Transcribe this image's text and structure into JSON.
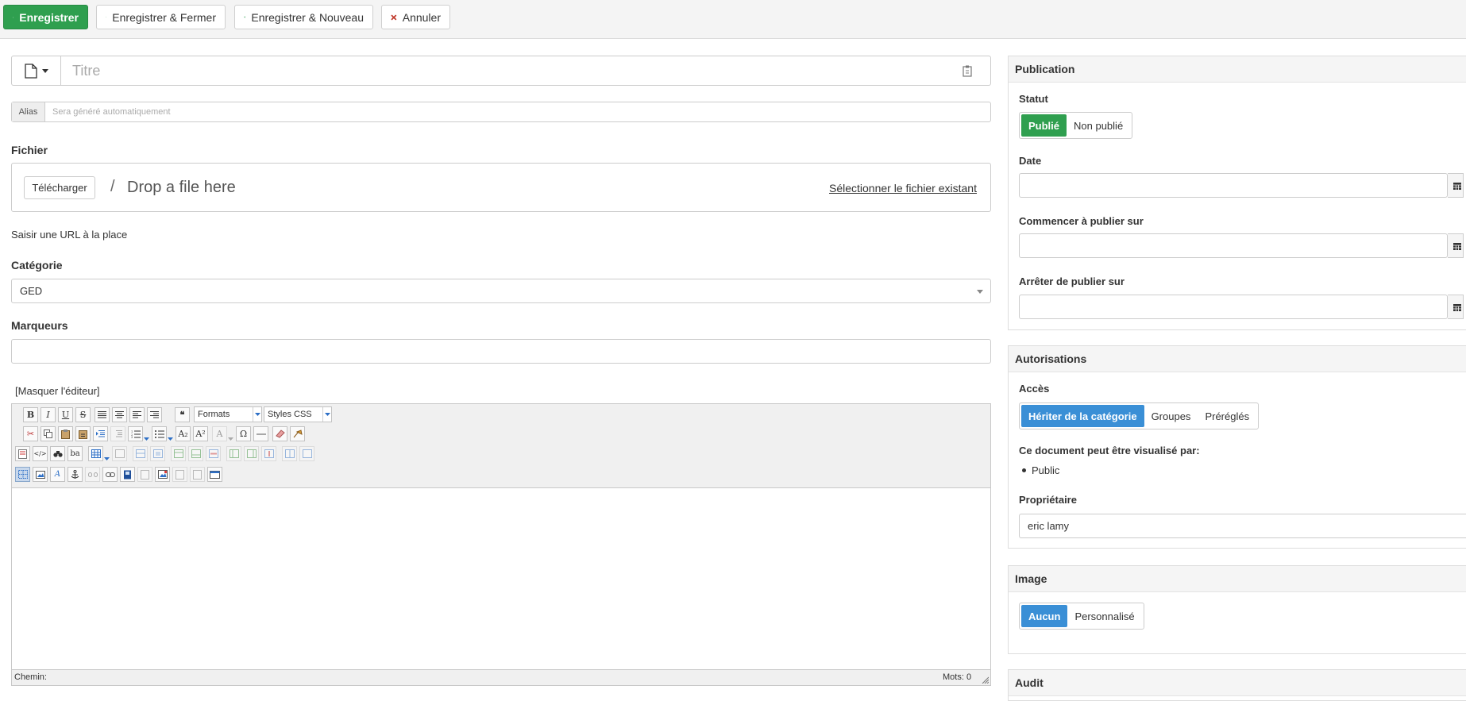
{
  "toolbar": {
    "save": "Enregistrer",
    "save_close": "Enregistrer & Fermer",
    "save_new": "Enregistrer & Nouveau",
    "cancel": "Annuler"
  },
  "form": {
    "title_placeholder": "Titre",
    "alias_label": "Alias",
    "alias_placeholder": "Sera généré automatiquement",
    "file_label": "Fichier",
    "upload_button": "Télécharger",
    "slash": "/",
    "drop_text": "Drop a file here",
    "select_existing": "Sélectionner le fichier existant",
    "enter_url": "Saisir une URL à la place",
    "category_label": "Catégorie",
    "category_value": "GED",
    "tags_label": "Marqueurs",
    "hide_editor": "[Masquer l'éditeur]"
  },
  "editor": {
    "format_select": "Formats",
    "styles_select": "Styles CSS",
    "status_path": "Chemin:",
    "word_count": "Mots: 0",
    "bold": "B",
    "italic": "I",
    "underline": "U",
    "strike": "S",
    "omega": "Ω"
  },
  "publication": {
    "title": "Publication",
    "status_label": "Statut",
    "published": "Publié",
    "unpublished": "Non publié",
    "date_label": "Date",
    "start_label": "Commencer à publier sur",
    "end_label": "Arrêter de publier sur"
  },
  "permissions": {
    "title": "Autorisations",
    "access_label": "Accès",
    "inherit": "Hériter de la catégorie",
    "groups": "Groupes",
    "presets": "Préréglés",
    "visible_by": "Ce document peut être visualisé par:",
    "viewers": [
      "Public"
    ],
    "owner_label": "Propriétaire",
    "owner_value": "eric lamy"
  },
  "image": {
    "title": "Image",
    "none": "Aucun",
    "custom": "Personnalisé"
  },
  "audit": {
    "title": "Audit"
  },
  "colors": {
    "green": "#2f9f4f",
    "blue": "#3a8fd6",
    "cancel_x": "#c0392b"
  }
}
